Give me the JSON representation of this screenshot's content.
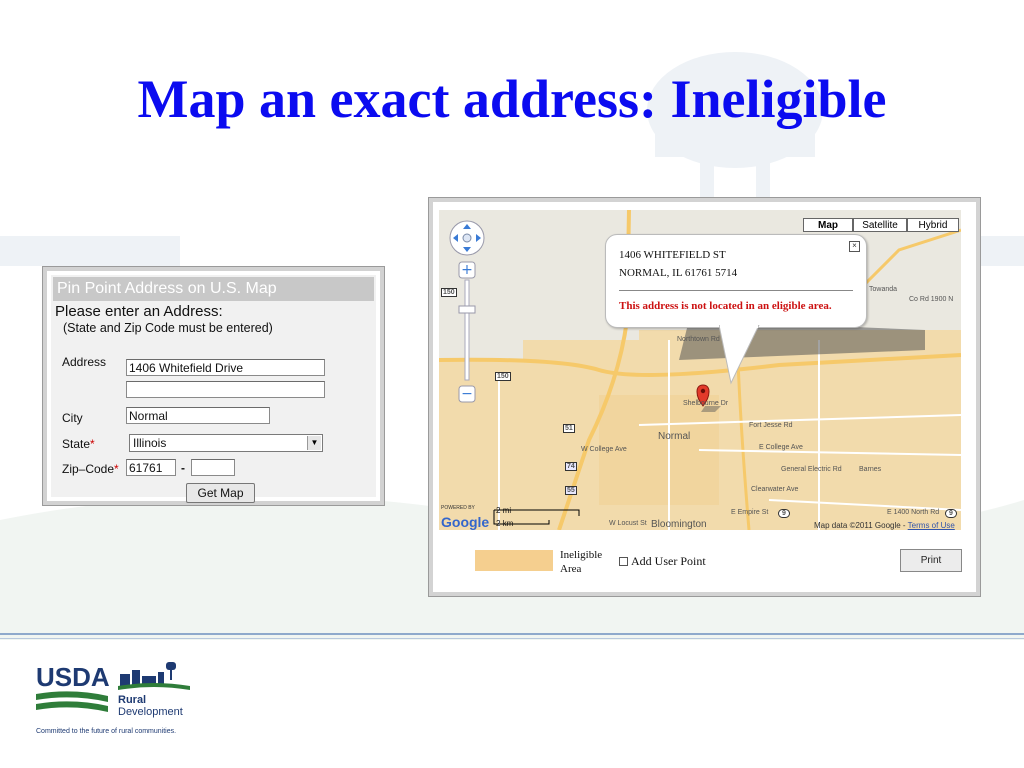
{
  "slide": {
    "title": "Map an exact address:  Ineligible"
  },
  "form": {
    "header": "Pin Point Address on U.S. Map",
    "prompt": "Please enter an Address:",
    "note": "(State and Zip Code must be entered)",
    "address_label": "Address",
    "address_line1": "1406 Whitefield Drive",
    "address_line2": "",
    "city_label": "City",
    "city_value": "Normal",
    "state_label": "State",
    "state_value": "Illinois",
    "zip_label": "Zip–Code",
    "required_mark": "*",
    "zip_value": "61761",
    "zip_separator": "-",
    "zip_ext_value": "",
    "submit_label": "Get Map"
  },
  "map": {
    "type_buttons": [
      "Map",
      "Satellite",
      "Hybrid"
    ],
    "active_type": "Map",
    "infobox": {
      "address_line1": "1406 WHITEFIELD ST",
      "address_line2": "NORMAL, IL 61761 5714",
      "message": "This address is not located in an eligible area.",
      "close_symbol": "×"
    },
    "labels": {
      "normal": "Normal",
      "bloomington": "Bloomington",
      "towanda": "Towanda",
      "co_rd_1900": "Co Rd 1900 N",
      "northtown": "Northtown Rd",
      "fort_jesse": "Fort Jesse Rd",
      "college_e": "E College Ave",
      "college_w": "W College Ave",
      "general_electric": "General Electric Rd",
      "barnes": "Barnes",
      "clearwater": "Clearwater Ave",
      "empire": "E Empire St",
      "locust": "W Locust St",
      "co_rd_1400": "E 1400 North Rd",
      "whitefield": "Shelbourne Dr"
    },
    "shields": [
      "150",
      "150",
      "51",
      "74",
      "55",
      "9",
      "9"
    ],
    "scale_mi": "2 mi",
    "scale_km": "2 km",
    "powered_by": "POWERED BY",
    "google": "Google",
    "copyright": "Map data ©2011 Google -",
    "terms": "Terms of Use"
  },
  "legend": {
    "label": "Ineligible Area",
    "swatch_color": "#f5cf8f",
    "checkbox_label": "Add User Point",
    "print_label": "Print"
  },
  "logo": {
    "usda": "USDA",
    "rural": "Rural",
    "development": "Development",
    "tagline": "Committed to the future of rural communities."
  },
  "colors": {
    "title": "#0b0bf0",
    "ineligible_fill": "#f5cf8f",
    "error_text": "#cc1111",
    "usda_blue": "#1e3a72",
    "usda_green": "#2f7d3a"
  }
}
